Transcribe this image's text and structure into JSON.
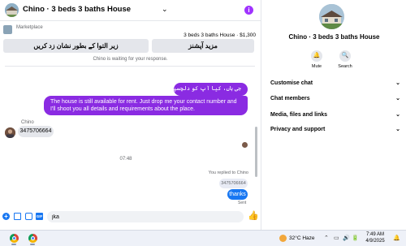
{
  "header": {
    "title": "Chino · 3 beds 3 baths House",
    "caret": "⌄",
    "info": "i"
  },
  "marketplace": {
    "label": "Marketplace",
    "listing_price": "3 beds 3 baths House · $1,300"
  },
  "quick_replies": [
    {
      "label": "زیر التوا کے بطور نشان زد کریں"
    },
    {
      "label": "مزید آپشنز"
    }
  ],
  "waiting_text": "Chino is waiting for your response.",
  "messages": {
    "outgoing_1": "جی ہاں، کیا آپ کو دلچسپی ہے؟",
    "outgoing_2": "The house is still available for rent. Just drop me your contact number and I'll shoot you all details and requirements about the place.",
    "sender_name": "Chino",
    "incoming_1": "3475706664",
    "timestamp": "07:48",
    "replied_to": "You replied to Chino",
    "quoted": "3475706664",
    "outgoing_3": "thanks",
    "status": "Sent"
  },
  "composer": {
    "value": "jka",
    "plus": "+",
    "gif": "GIF",
    "like": "👍"
  },
  "sidebar": {
    "name": "Chino · 3 beds 3 baths House",
    "mute_label": "Mute",
    "search_label": "Search",
    "mute_glyph": "🔔",
    "search_glyph": "🔍",
    "items": [
      {
        "label": "Customise chat"
      },
      {
        "label": "Chat members"
      },
      {
        "label": "Media, files and links"
      },
      {
        "label": "Privacy and support"
      }
    ],
    "chevron": "⌄"
  },
  "taskbar": {
    "temperature": "32°C  Haze",
    "tray_icons": [
      "⌃",
      "▭",
      "🔊",
      "🔋"
    ],
    "time": "7:49 AM",
    "date": "4/9/2025",
    "bell": "🔔"
  },
  "colors": {
    "outgoing_bubble": "#8a2be2",
    "last_bubble": "#1877f2",
    "accent": "#1877f2"
  }
}
